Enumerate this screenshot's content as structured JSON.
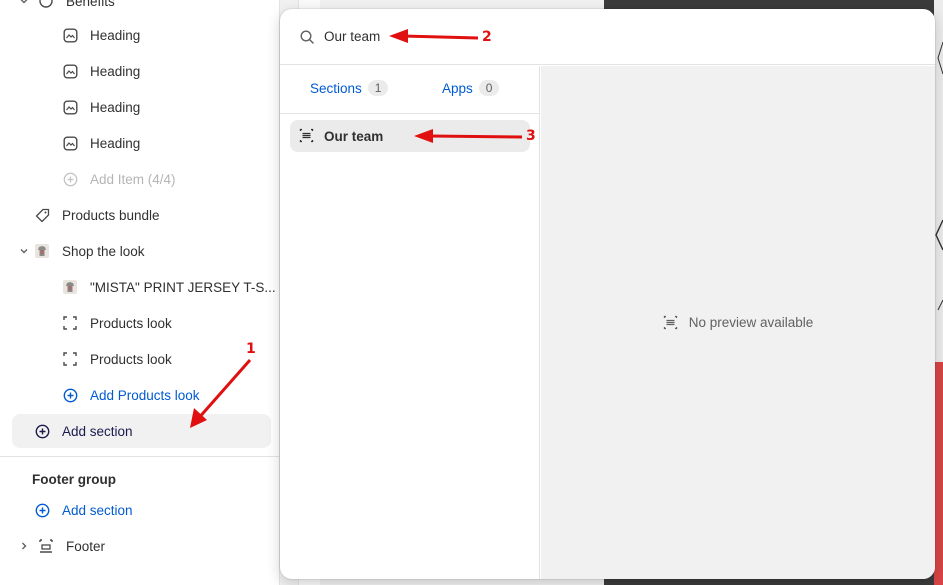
{
  "sidebar": {
    "top_item_label": "Benefits",
    "benefit_items": [
      {
        "label": "Heading"
      },
      {
        "label": "Heading"
      },
      {
        "label": "Heading"
      },
      {
        "label": "Heading"
      }
    ],
    "add_item_label": "Add Item (4/4)",
    "products_bundle_label": "Products bundle",
    "shop_the_look": {
      "label": "Shop the look",
      "children": [
        {
          "label": "\"MISTA\" PRINT JERSEY T-S..."
        },
        {
          "label": "Products look"
        },
        {
          "label": "Products look"
        }
      ],
      "add_label": "Add Products look"
    },
    "add_section_label": "Add section",
    "footer_group": {
      "title": "Footer group",
      "add_section_label": "Add section",
      "footer_label": "Footer"
    }
  },
  "popover": {
    "search_value": "Our team",
    "tabs": [
      {
        "label": "Sections",
        "count": "1"
      },
      {
        "label": "Apps",
        "count": "0"
      }
    ],
    "result_label": "Our team",
    "preview_text": "No preview available"
  },
  "annotations": [
    "1",
    "2",
    "3"
  ],
  "colors": {
    "accent_blue": "#005bd3",
    "annotation_red": "#e01010"
  }
}
